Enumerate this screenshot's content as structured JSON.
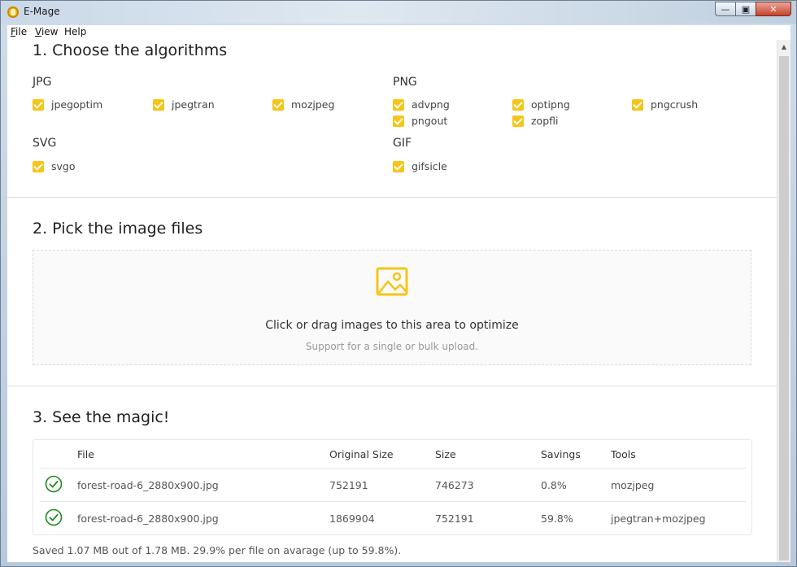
{
  "window": {
    "title": "E-Mage"
  },
  "menu": [
    {
      "label": "File",
      "accel": "F",
      "rest": "ile"
    },
    {
      "label": "View",
      "accel": "V",
      "rest": "iew"
    },
    {
      "label": "Help",
      "accel": "",
      "rest": "Help"
    }
  ],
  "sections": {
    "algorithms": "1. Choose the algorithms",
    "files": "2. Pick the image files",
    "results": "3. See the magic!"
  },
  "groups": {
    "jpg": {
      "title": "JPG",
      "items": [
        "jpegoptim",
        "jpegtran",
        "mozjpeg"
      ]
    },
    "png": {
      "title": "PNG",
      "items": [
        "advpng",
        "optipng",
        "pngcrush",
        "pngout",
        "zopfli"
      ]
    },
    "svg": {
      "title": "SVG",
      "items": [
        "svgo"
      ]
    },
    "gif": {
      "title": "GIF",
      "items": [
        "gifsicle"
      ]
    }
  },
  "dropzone": {
    "text": "Click or drag images to this area to optimize",
    "hint": "Support for a single or bulk upload."
  },
  "table": {
    "headers": [
      "File",
      "Original Size",
      "Size",
      "Savings",
      "Tools"
    ],
    "rows": [
      [
        "forest-road-6_2880x900.jpg",
        "752191",
        "746273",
        "0.8%",
        "mozjpeg"
      ],
      [
        "forest-road-6_2880x900.jpg",
        "1869904",
        "752191",
        "59.8%",
        "jpegtran+mozjpeg"
      ]
    ]
  },
  "summary": "Saved 1.07 MB out of 1.78 MB. 29.9% per file on avarage (up to 59.8%).",
  "colors": {
    "accent": "#F5C518",
    "success": "#1a8a1a"
  }
}
